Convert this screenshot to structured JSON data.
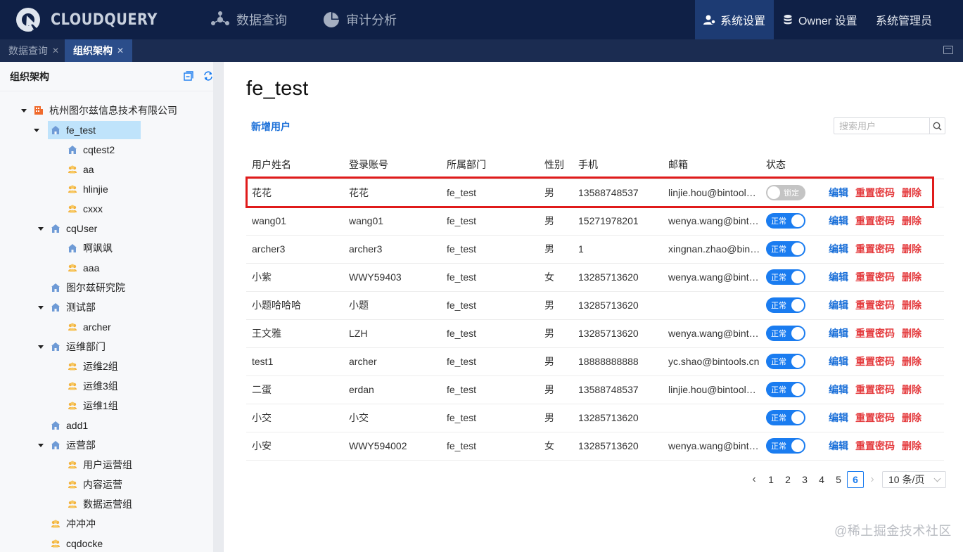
{
  "app": {
    "logo_text": "CLOUDQUERY",
    "nav": [
      {
        "label": "数据查询",
        "icon": "data-query-icon"
      },
      {
        "label": "审计分析",
        "icon": "pie-chart-icon"
      }
    ],
    "nav_right": [
      {
        "label": "系统设置",
        "icon": "user-settings-icon",
        "active": true
      },
      {
        "label": "Owner 设置",
        "icon": "database-icon"
      },
      {
        "label": "系统管理员"
      }
    ]
  },
  "tabs": [
    {
      "label": "数据查询",
      "active": false
    },
    {
      "label": "组织架构",
      "active": true
    }
  ],
  "sidebar": {
    "title": "组织架构",
    "tree": [
      {
        "label": "杭州图尔兹信息技术有限公司",
        "icon": "company-icon",
        "level": 0,
        "expanded": true
      },
      {
        "label": "fe_test",
        "icon": "department-icon",
        "level": 1,
        "expanded": true,
        "selected": true
      },
      {
        "label": "cqtest2",
        "icon": "department-icon",
        "level": 2
      },
      {
        "label": "aa",
        "icon": "group-icon",
        "level": 2
      },
      {
        "label": "hlinjie",
        "icon": "group-icon",
        "level": 2
      },
      {
        "label": "cxxx",
        "icon": "group-icon",
        "level": 2
      },
      {
        "label": "cqUser",
        "icon": "department-icon",
        "level": 1,
        "expanded": true
      },
      {
        "label": "啊飒飒",
        "icon": "department-icon",
        "level": 2
      },
      {
        "label": "aaa",
        "icon": "group-icon",
        "level": 2
      },
      {
        "label": "图尔兹研究院",
        "icon": "department-icon",
        "level": 1
      },
      {
        "label": "测试部",
        "icon": "department-icon",
        "level": 1,
        "expanded": true
      },
      {
        "label": "archer",
        "icon": "group-icon",
        "level": 2
      },
      {
        "label": "运维部门",
        "icon": "department-icon",
        "level": 1,
        "expanded": true
      },
      {
        "label": "运维2组",
        "icon": "group-icon",
        "level": 2
      },
      {
        "label": "运维3组",
        "icon": "group-icon",
        "level": 2
      },
      {
        "label": "运维1组",
        "icon": "group-icon",
        "level": 2
      },
      {
        "label": "add1",
        "icon": "department-icon",
        "level": 1
      },
      {
        "label": "运营部",
        "icon": "department-icon",
        "level": 1,
        "expanded": true
      },
      {
        "label": "用户运营组",
        "icon": "group-icon",
        "level": 2
      },
      {
        "label": "内容运营",
        "icon": "group-icon",
        "level": 2
      },
      {
        "label": "数据运营组",
        "icon": "group-icon",
        "level": 2
      },
      {
        "label": "冲冲冲",
        "icon": "group-icon",
        "level": 1
      },
      {
        "label": "cqdocke",
        "icon": "group-icon",
        "level": 1
      }
    ]
  },
  "main": {
    "title": "fe_test",
    "add_user_label": "新增用户",
    "search_placeholder": "搜索用户",
    "columns": [
      "用户姓名",
      "登录账号",
      "所属部门",
      "性别",
      "手机",
      "邮箱",
      "状态"
    ],
    "rows": [
      {
        "name": "花花",
        "account": "花花",
        "dept": "fe_test",
        "gender": "男",
        "phone": "13588748537",
        "email": "linjie.hou@bintools.cn",
        "status_on": false,
        "status_label": "锁定"
      },
      {
        "name": "wang01",
        "account": "wang01",
        "dept": "fe_test",
        "gender": "男",
        "phone": "15271978201",
        "email": "wenya.wang@bintools.cn",
        "status_on": true,
        "status_label": "正常"
      },
      {
        "name": "archer3",
        "account": "archer3",
        "dept": "fe_test",
        "gender": "男",
        "phone": "1",
        "email": "xingnan.zhao@bintools.cn",
        "status_on": true,
        "status_label": "正常"
      },
      {
        "name": "小紫",
        "account": "WWY59403",
        "dept": "fe_test",
        "gender": "女",
        "phone": "13285713620",
        "email": "wenya.wang@bintools.cn",
        "status_on": true,
        "status_label": "正常"
      },
      {
        "name": "小题哈哈哈",
        "account": "小题",
        "dept": "fe_test",
        "gender": "男",
        "phone": "13285713620",
        "email": "",
        "status_on": true,
        "status_label": "正常"
      },
      {
        "name": "王文雅",
        "account": "LZH",
        "dept": "fe_test",
        "gender": "男",
        "phone": "13285713620",
        "email": "wenya.wang@bintools.cn",
        "status_on": true,
        "status_label": "正常"
      },
      {
        "name": "test1",
        "account": "archer",
        "dept": "fe_test",
        "gender": "男",
        "phone": "18888888888",
        "email": "yc.shao@bintools.cn",
        "status_on": true,
        "status_label": "正常"
      },
      {
        "name": "二蛋",
        "account": "erdan",
        "dept": "fe_test",
        "gender": "男",
        "phone": "13588748537",
        "email": "linjie.hou@bintools.cn",
        "status_on": true,
        "status_label": "正常"
      },
      {
        "name": "小交",
        "account": "小交",
        "dept": "fe_test",
        "gender": "男",
        "phone": "13285713620",
        "email": "",
        "status_on": true,
        "status_label": "正常"
      },
      {
        "name": "小安",
        "account": "WWY594002",
        "dept": "fe_test",
        "gender": "女",
        "phone": "13285713620",
        "email": "wenya.wang@bintools.cn",
        "status_on": true,
        "status_label": "正常"
      }
    ],
    "actions": {
      "edit": "编辑",
      "reset": "重置密码",
      "delete": "删除"
    },
    "pagination": {
      "pages": [
        "1",
        "2",
        "3",
        "4",
        "5",
        "6"
      ],
      "current": "6",
      "page_size": "10 条/页"
    }
  },
  "watermark": "@稀土掘金技术社区",
  "colors": {
    "topbar": "#0f2046",
    "tabstrip": "#1b2c51",
    "accent": "#1a7cf0",
    "danger": "#e4393c",
    "highlight": "#e01b1b"
  }
}
